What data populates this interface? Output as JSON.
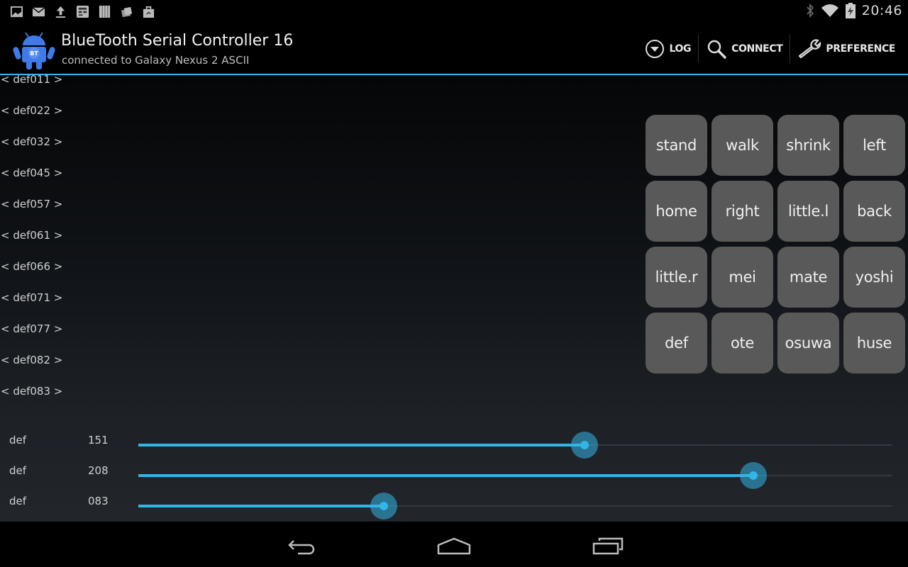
{
  "status_bar": {
    "notification_icons": [
      "gallery-icon",
      "gmail-icon",
      "upload-icon",
      "news-widget-icon",
      "barcode-icon",
      "market-update-icon",
      "shopping-bag-icon"
    ],
    "system_icons": [
      "bluetooth-icon",
      "wifi-icon",
      "battery-charging-icon"
    ],
    "time": "20:46"
  },
  "action_bar": {
    "app_icon": "bt-android-icon",
    "title": "BlueTooth Serial Controller 16",
    "subtitle": "connected to Galaxy Nexus 2  ASCII",
    "actions": [
      {
        "icon": "dropdown-circle-icon",
        "label": "LOG"
      },
      {
        "icon": "search-icon",
        "label": "CONNECT"
      },
      {
        "icon": "wrench-icon",
        "label": "PREFERENCE"
      }
    ]
  },
  "accent_color": "#33b5e5",
  "list_items": [
    "< def011 >",
    "< def022 >",
    "< def032 >",
    "< def045 >",
    "< def057 >",
    "< def061 >",
    "< def066 >",
    "< def071 >",
    "< def077 >",
    "< def082 >",
    "< def083 >"
  ],
  "buttons": [
    "stand",
    "walk",
    "shrink",
    "left",
    "home",
    "right",
    "little.l",
    "back",
    "little.r",
    "mei",
    "mate",
    "yoshi",
    "def",
    "ote",
    "osuwa",
    "huse"
  ],
  "sliders": [
    {
      "label": "def",
      "value_text": "151",
      "value": 151,
      "max": 255
    },
    {
      "label": "def",
      "value_text": "208",
      "value": 208,
      "max": 255
    },
    {
      "label": "def",
      "value_text": "083",
      "value": 83,
      "max": 255
    }
  ],
  "nav_bar": {
    "buttons": [
      "back-icon",
      "home-icon",
      "recent-apps-icon"
    ]
  }
}
